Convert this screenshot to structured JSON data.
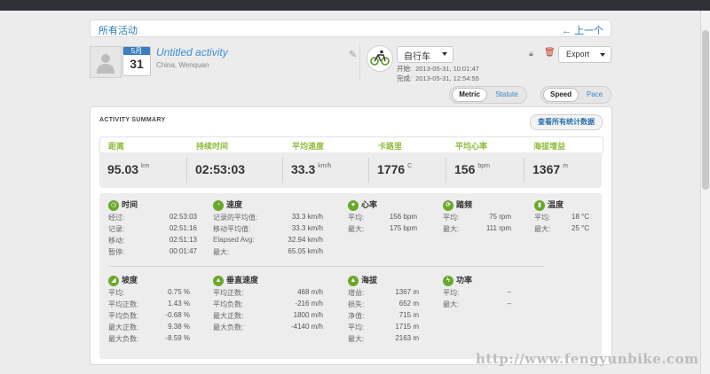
{
  "breadcrumb": {
    "all_label": "所有活动",
    "prev_label": "← 上一个"
  },
  "activity": {
    "month": "5月",
    "day": "31",
    "title": "Untitled activity",
    "location": "China, Wenquan",
    "sport": "自行车",
    "start_label": "开始:",
    "start_time": "2013-05-31, 10:01:47",
    "end_label": "完成:",
    "end_time": "2013-05-31, 12:54:55"
  },
  "toolbar": {
    "export_label": "Export"
  },
  "units_toggle": {
    "metric": "Metric",
    "statute": "Statute"
  },
  "speed_toggle": {
    "speed": "Speed",
    "pace": "Pace"
  },
  "summary": {
    "title": "ACTIVITY SUMMARY",
    "all_stats_label": "查看所有统计数据",
    "headers": [
      "距离",
      "持续时间",
      "平均速度",
      "卡路里",
      "平均心率",
      "海拔增益"
    ],
    "values": [
      {
        "value": "95.03",
        "unit": "km"
      },
      {
        "value": "02:53:03",
        "unit": ""
      },
      {
        "value": "33.3",
        "unit": "km/h"
      },
      {
        "value": "1776",
        "unit": "C"
      },
      {
        "value": "156",
        "unit": "bpm"
      },
      {
        "value": "1367",
        "unit": "m"
      }
    ]
  },
  "sections": {
    "time": {
      "title": "时间",
      "rows": [
        {
          "label": "经过:",
          "value": "02:53:03"
        },
        {
          "label": "记录:",
          "value": "02:51:16"
        },
        {
          "label": "移动:",
          "value": "02:51:13"
        },
        {
          "label": "暂停:",
          "value": "00:01:47"
        }
      ]
    },
    "speed": {
      "title": "速度",
      "rows": [
        {
          "label": "记录的平均值:",
          "value": "33.3 km/h"
        },
        {
          "label": "移动平均值:",
          "value": "33.3 km/h"
        },
        {
          "label": "Elapsed Avg:",
          "value": "32.94 km/h"
        },
        {
          "label": "最大:",
          "value": "65.05 km/h"
        }
      ]
    },
    "heart": {
      "title": "心率",
      "rows": [
        {
          "label": "平均:",
          "value": "156 bpm"
        },
        {
          "label": "最大:",
          "value": "175 bpm"
        }
      ]
    },
    "cadence": {
      "title": "踏频",
      "rows": [
        {
          "label": "平均:",
          "value": "75 rpm"
        },
        {
          "label": "最大:",
          "value": "111 rpm"
        }
      ]
    },
    "temp": {
      "title": "温度",
      "rows": [
        {
          "label": "平均:",
          "value": "18 °C"
        },
        {
          "label": "最大:",
          "value": "25 °C"
        }
      ]
    },
    "grade": {
      "title": "坡度",
      "rows": [
        {
          "label": "平均:",
          "value": "0.75 %"
        },
        {
          "label": "平均正数:",
          "value": "1.43 %"
        },
        {
          "label": "平均负数:",
          "value": "-0.68 %"
        },
        {
          "label": "最大正数:",
          "value": "9.38 %"
        },
        {
          "label": "最大负数:",
          "value": "-8.59 %"
        }
      ]
    },
    "vspeed": {
      "title": "垂直速度",
      "rows": [
        {
          "label": "平均正数:",
          "value": "468 m/h"
        },
        {
          "label": "平均负数:",
          "value": "-216 m/h"
        },
        {
          "label": "最大正数:",
          "value": "1800 m/h"
        },
        {
          "label": "最大负数:",
          "value": "-4140 m/h"
        }
      ]
    },
    "elev": {
      "title": "海拔",
      "rows": [
        {
          "label": "增益:",
          "value": "1367 m"
        },
        {
          "label": "损失:",
          "value": "652 m"
        },
        {
          "label": "净值:",
          "value": "715 m"
        },
        {
          "label": "平均:",
          "value": "1715 m"
        },
        {
          "label": "最大:",
          "value": "2163 m"
        }
      ]
    },
    "power": {
      "title": "功率",
      "rows": [
        {
          "label": "平均:",
          "value": "–"
        },
        {
          "label": "最大:",
          "value": "–"
        }
      ]
    }
  },
  "watermark": "http://www.fengyunbike.com",
  "colors": {
    "accent": "#3a86c8",
    "header_green": "#8dbd3a",
    "icon_green": "#6aa82c"
  }
}
